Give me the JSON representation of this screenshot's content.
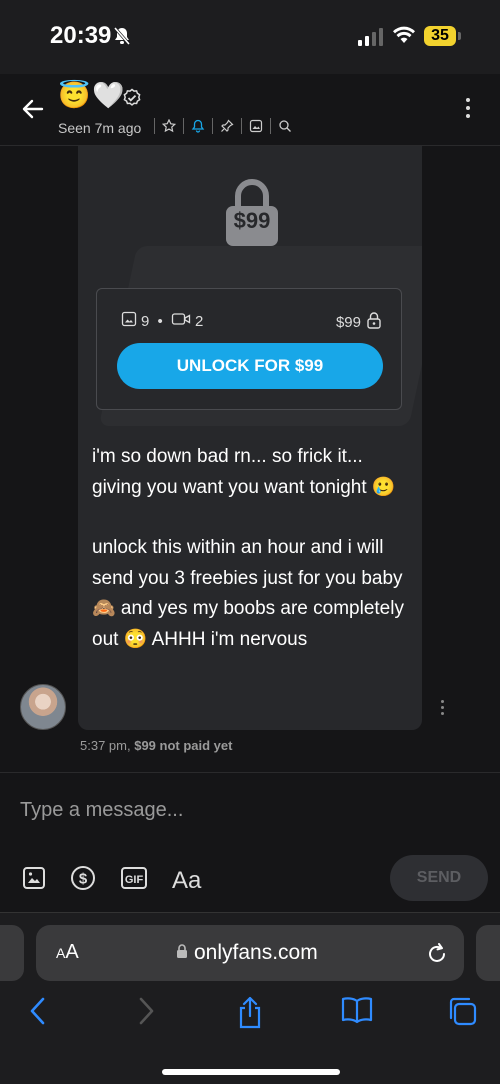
{
  "status_bar": {
    "time": "20:39",
    "battery": "35"
  },
  "header": {
    "name_emoji": "😇🤍",
    "seen": "Seen 7m ago"
  },
  "post": {
    "lock_price": "$99",
    "media": {
      "photos": "9",
      "videos": "2",
      "price": "$99"
    },
    "unlock_label": "UNLOCK FOR $99",
    "message_paragraph_1": "i'm so down bad rn... so frick it... giving you want you want tonight 🥲",
    "message_paragraph_2": "unlock this within an hour and i will send you 3 freebies just for you baby 🙈 and yes my boobs are completely out 😳 AHHH i'm nervous",
    "meta_time": "5:37 pm,",
    "meta_status": "$99 not paid yet"
  },
  "composer": {
    "placeholder": "Type a message...",
    "text_tool_label": "Aa",
    "send_label": "SEND"
  },
  "browser": {
    "aa_label_small": "A",
    "aa_label_large": "A",
    "url": "onlyfans.com"
  },
  "colors": {
    "accent": "#18a7e8",
    "background": "#151517",
    "bubble": "#27282b",
    "battery": "#f2d22e"
  }
}
